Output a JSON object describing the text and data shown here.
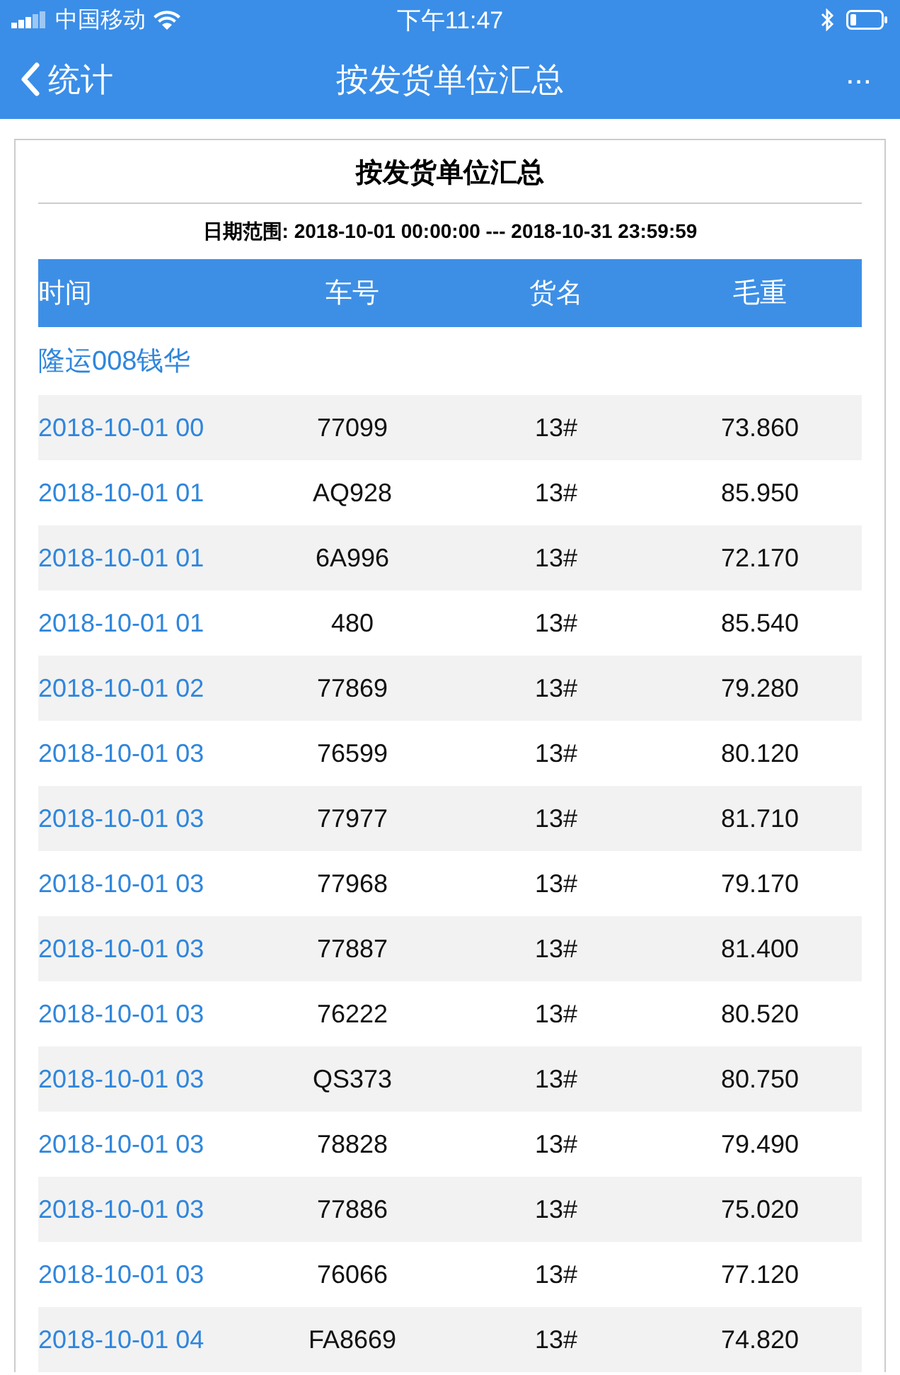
{
  "status_bar": {
    "carrier": "中国移动",
    "time": "下午11:47"
  },
  "nav_bar": {
    "back_label": "统计",
    "title": "按发货单位汇总",
    "more": "..."
  },
  "report": {
    "title": "按发货单位汇总",
    "date_range": "日期范围: 2018-10-01 00:00:00 --- 2018-10-31 23:59:59",
    "columns": [
      "时间",
      "车号",
      "货名",
      "毛重"
    ],
    "group": "隆运008钱华",
    "rows": [
      {
        "time": "2018-10-01 00",
        "plate": "77099",
        "goods": "13#",
        "weight": "73.860"
      },
      {
        "time": "2018-10-01 01",
        "plate": "AQ928",
        "goods": "13#",
        "weight": "85.950"
      },
      {
        "time": "2018-10-01 01",
        "plate": "6A996",
        "goods": "13#",
        "weight": "72.170"
      },
      {
        "time": "2018-10-01 01",
        "plate": "480",
        "goods": "13#",
        "weight": "85.540"
      },
      {
        "time": "2018-10-01 02",
        "plate": "77869",
        "goods": "13#",
        "weight": "79.280"
      },
      {
        "time": "2018-10-01 03",
        "plate": "76599",
        "goods": "13#",
        "weight": "80.120"
      },
      {
        "time": "2018-10-01 03",
        "plate": "77977",
        "goods": "13#",
        "weight": "81.710"
      },
      {
        "time": "2018-10-01 03",
        "plate": "77968",
        "goods": "13#",
        "weight": "79.170"
      },
      {
        "time": "2018-10-01 03",
        "plate": "77887",
        "goods": "13#",
        "weight": "81.400"
      },
      {
        "time": "2018-10-01 03",
        "plate": "76222",
        "goods": "13#",
        "weight": "80.520"
      },
      {
        "time": "2018-10-01 03",
        "plate": "QS373",
        "goods": "13#",
        "weight": "80.750"
      },
      {
        "time": "2018-10-01 03",
        "plate": "78828",
        "goods": "13#",
        "weight": "79.490"
      },
      {
        "time": "2018-10-01 03",
        "plate": "77886",
        "goods": "13#",
        "weight": "75.020"
      },
      {
        "time": "2018-10-01 03",
        "plate": "76066",
        "goods": "13#",
        "weight": "77.120"
      },
      {
        "time": "2018-10-01 04",
        "plate": "FA8669",
        "goods": "13#",
        "weight": "74.820"
      }
    ]
  }
}
